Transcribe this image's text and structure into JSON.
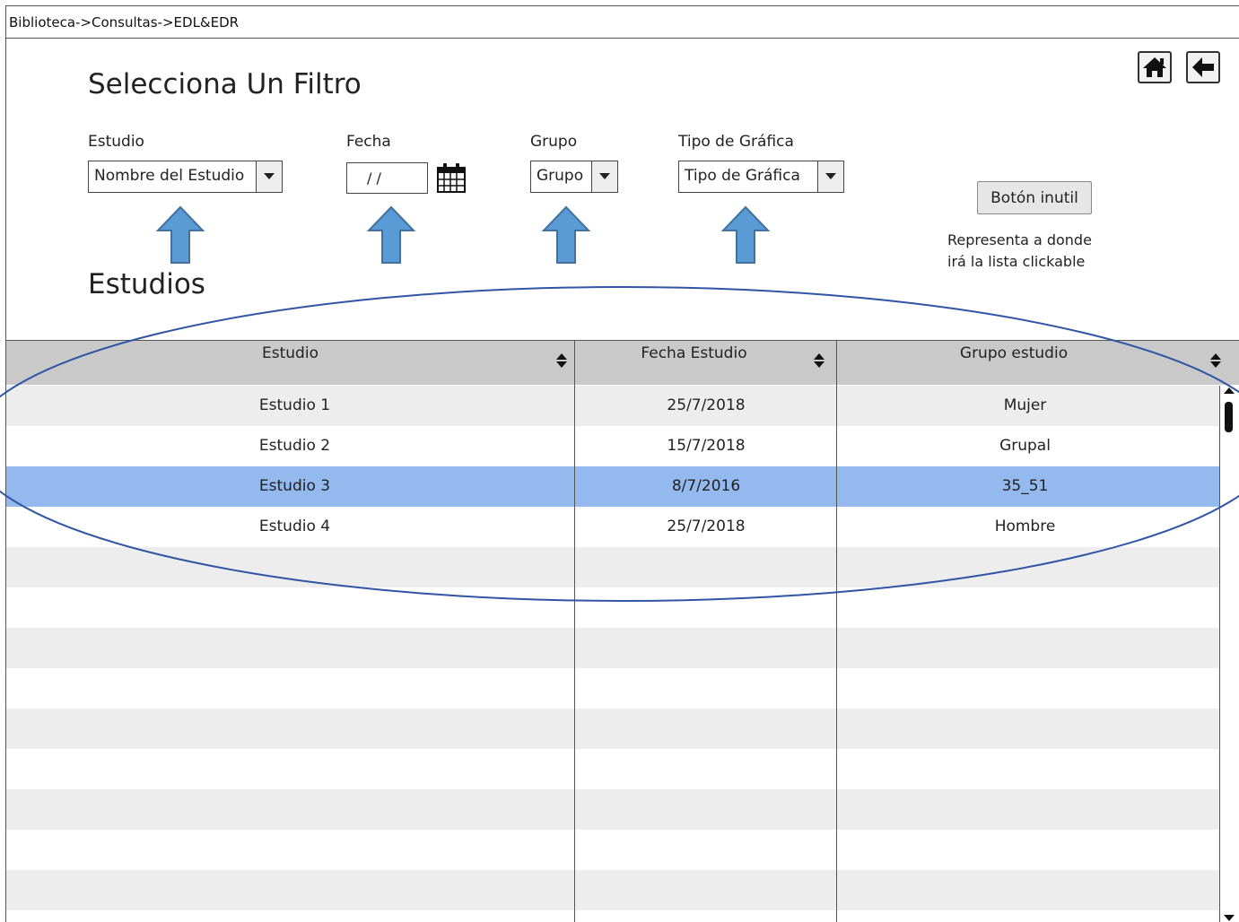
{
  "breadcrumb": "Biblioteca->Consultas->EDL&EDR",
  "toolbar": {
    "home_icon": "home-icon",
    "back_icon": "arrow-left-icon"
  },
  "filters": {
    "title": "Selecciona Un Filtro",
    "estudio": {
      "label": "Estudio",
      "value": "Nombre del Estudio"
    },
    "fecha": {
      "label": "Fecha",
      "value": "/ /"
    },
    "grupo": {
      "label": "Grupo",
      "value": "Grupo"
    },
    "tipo_grafica": {
      "label": "Tipo de Gráfica",
      "value": "Tipo de Gráfica"
    }
  },
  "useless_button": {
    "label": "Botón inutil",
    "note_line1": "Representa a donde",
    "note_line2": "irá la lista clickable"
  },
  "studies": {
    "title": "Estudios",
    "columns": [
      "Estudio",
      "Fecha Estudio",
      "Grupo estudio"
    ],
    "rows": [
      [
        "Estudio 1",
        "25/7/2018",
        "Mujer"
      ],
      [
        "Estudio 2",
        "15/7/2018",
        "Grupal"
      ],
      [
        "Estudio 3",
        "8/7/2016",
        "35_51"
      ],
      [
        "Estudio 4",
        "25/7/2018",
        "Hombre"
      ]
    ],
    "selected_row": 3
  },
  "colors": {
    "arrow_fill": "#5b9bd5",
    "annotation_stroke": "#2f55a4",
    "selected_row": "#93b9ee"
  }
}
